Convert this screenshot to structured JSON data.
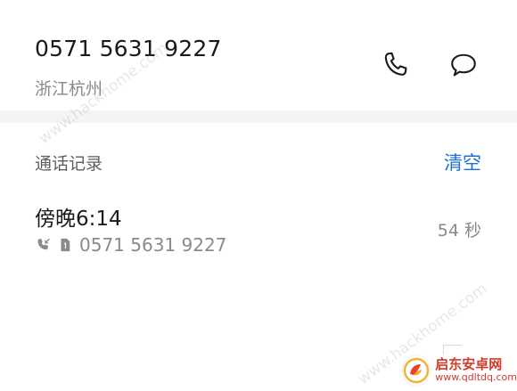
{
  "contact": {
    "phone_number": "0571 5631 9227",
    "location": "浙江杭州"
  },
  "actions": {
    "call_icon": "phone-icon",
    "message_icon": "message-bubble-icon"
  },
  "call_log": {
    "title": "通话记录",
    "clear_label": "清空",
    "entries": [
      {
        "time": "傍晚6:14",
        "number": "0571 5631 9227",
        "duration": "54 秒",
        "call_type_icon": "incoming-call-icon",
        "sim_icon": "sim-1-icon"
      }
    ]
  },
  "watermarks": {
    "site_top": "www.hackhome.com",
    "site_bottom": "www.hackhome.com"
  },
  "brand_badge": {
    "name": "启东安卓网",
    "url": "www.qdltdq.com"
  },
  "colors": {
    "accent": "#1e6fd0",
    "primary_text": "#1a1a1a",
    "secondary_text": "#8a8a8a",
    "divider": "#f4f4f4",
    "brand": "#d13b2b"
  }
}
